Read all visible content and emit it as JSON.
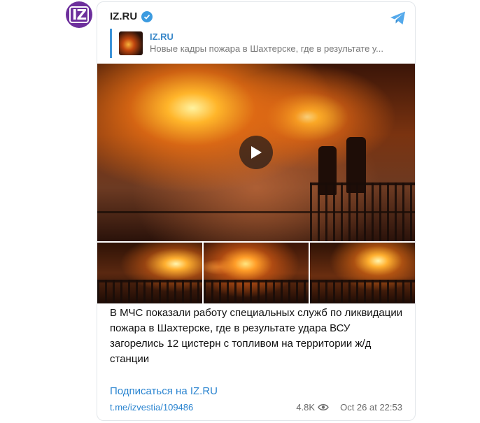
{
  "channel": {
    "name": "IZ.RU",
    "avatar_text": "IZ",
    "verified": true
  },
  "reply": {
    "title": "IZ.RU",
    "snippet": "Новые кадры пожара в Шахтерске, где в результате у..."
  },
  "post": {
    "text": "В МЧС показали работу специальных служб по ликвидации пожара в Шахтерске, где в результате удара ВСУ загорелись 12 цистерн с топливом на территории ж/д станции",
    "subscribe_label": "Подписаться на IZ.RU",
    "link": "t.me/izvestia/109486",
    "views": "4.8K",
    "date": "Oct 26 at 22:53"
  },
  "colors": {
    "accent": "#2a84d0",
    "avatar_bg": "#6d2f9c",
    "verified": "#3c9be0"
  },
  "icons": [
    "telegram-icon",
    "verified-icon",
    "play-icon",
    "eye-icon"
  ]
}
